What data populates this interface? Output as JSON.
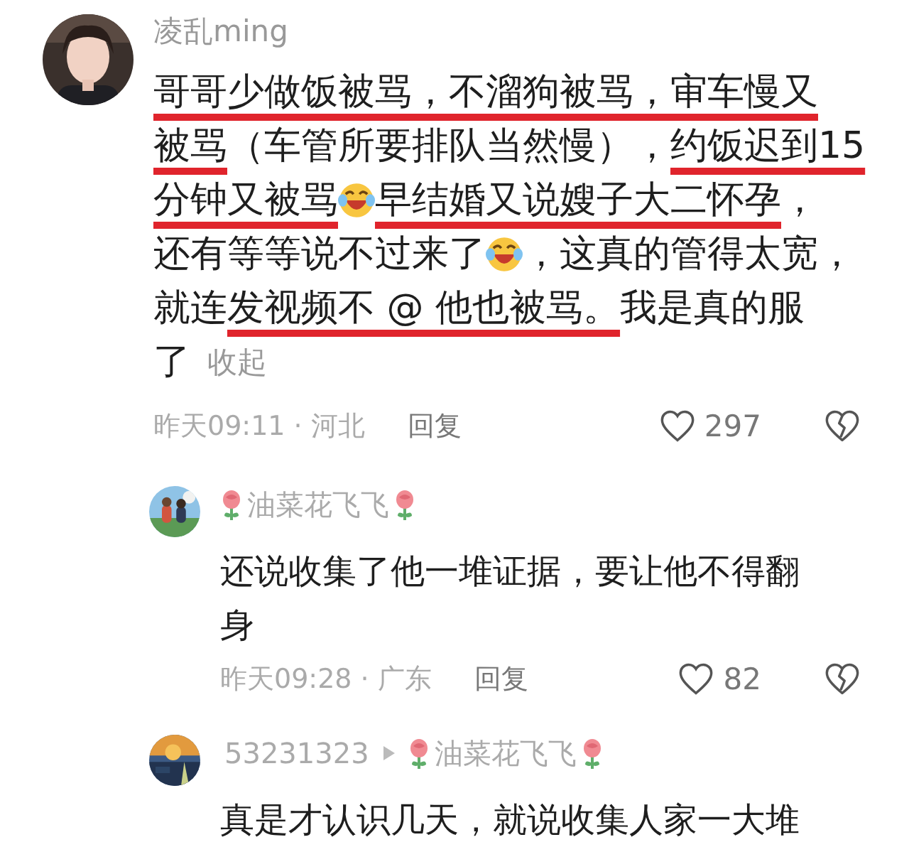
{
  "comment": {
    "author": "凌乱ming",
    "lines": [
      [
        {
          "kind": "text",
          "text": "哥哥少做饭被骂，不溜狗被骂，审",
          "underlined": true
        },
        {
          "kind": "text",
          "text": "车慢又",
          "underlined": true
        }
      ],
      [
        {
          "kind": "text",
          "text": "被骂",
          "underlined": true
        },
        {
          "kind": "text",
          "text": "（车管所要排队当然慢），",
          "underlined": false
        },
        {
          "kind": "text",
          "text": "约饭迟到15",
          "underlined": true
        }
      ],
      [
        {
          "kind": "text",
          "text": "分钟又被骂",
          "underlined": true
        },
        {
          "kind": "emoji"
        },
        {
          "kind": "text",
          "text": "早结婚又说嫂子大二怀孕",
          "underlined": true
        },
        {
          "kind": "text",
          "text": "，",
          "underlined": false
        }
      ],
      [
        {
          "kind": "text",
          "text": "还有等等说不过来了",
          "underlined": false
        },
        {
          "kind": "emoji"
        },
        {
          "kind": "text",
          "text": "，这真的管得太宽，",
          "underlined": false
        }
      ],
      [
        {
          "kind": "text",
          "text": "就连",
          "underlined": false
        },
        {
          "kind": "text",
          "text": "发视频不 @ 他也被骂。",
          "underlined": true
        },
        {
          "kind": "text",
          "text": "我是真的服",
          "underlined": false
        }
      ],
      [
        {
          "kind": "text",
          "text": "了",
          "underlined": false
        },
        {
          "kind": "link",
          "text": "收起"
        }
      ]
    ],
    "meta": "昨天09:11 · 河北",
    "reply_label": "回复",
    "likes": "297",
    "replies": [
      {
        "author": "油菜花飞飞",
        "rose": true,
        "lines": [
          "还说收集了他一堆证据，要让他不得翻",
          "身"
        ],
        "meta": "昨天09:28 · 广东",
        "reply_label": "回复",
        "likes": "82"
      },
      {
        "author": "53231323",
        "reply_to": {
          "name": "油菜花飞飞",
          "rose": true
        },
        "lines": [
          "真是才认识几天，就说收集人家一大堆"
        ]
      }
    ]
  }
}
